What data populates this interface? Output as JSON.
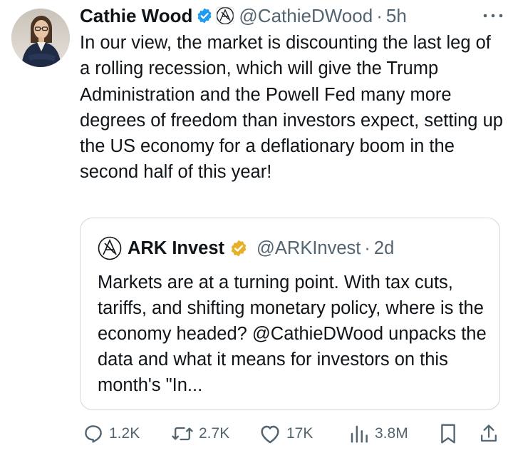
{
  "tweet": {
    "author": {
      "display_name": "Cathie Wood",
      "handle": "@CathieDWood",
      "separator": "·",
      "time": "5h",
      "verified_color": "#1d9bf0"
    },
    "text": "In our view, the market is discounting the last leg of a rolling recession, which will give the Trump Administration and the Powell Fed many more degrees of freedom than investors expect, setting up the US economy for a deflationary boom in the second half of this year!"
  },
  "quote": {
    "author": {
      "display_name": "ARK Invest",
      "handle": "@ARKInvest",
      "separator": "·",
      "time": "2d",
      "badge_color": "#e8b028"
    },
    "text": "Markets are at a turning point. With tax cuts, tariffs, and shifting monetary policy, where is the economy headed? @CathieDWood unpacks the data and what it means for investors on this month's \"In..."
  },
  "actions": {
    "replies": "1.2K",
    "reposts": "2.7K",
    "likes": "17K",
    "views": "3.8M"
  },
  "icons": {
    "more": "more-horizontal-icon",
    "reply": "reply-icon",
    "repost": "repost-icon",
    "like": "heart-icon",
    "views": "views-bar-chart-icon",
    "bookmark": "bookmark-icon",
    "share": "share-icon"
  }
}
